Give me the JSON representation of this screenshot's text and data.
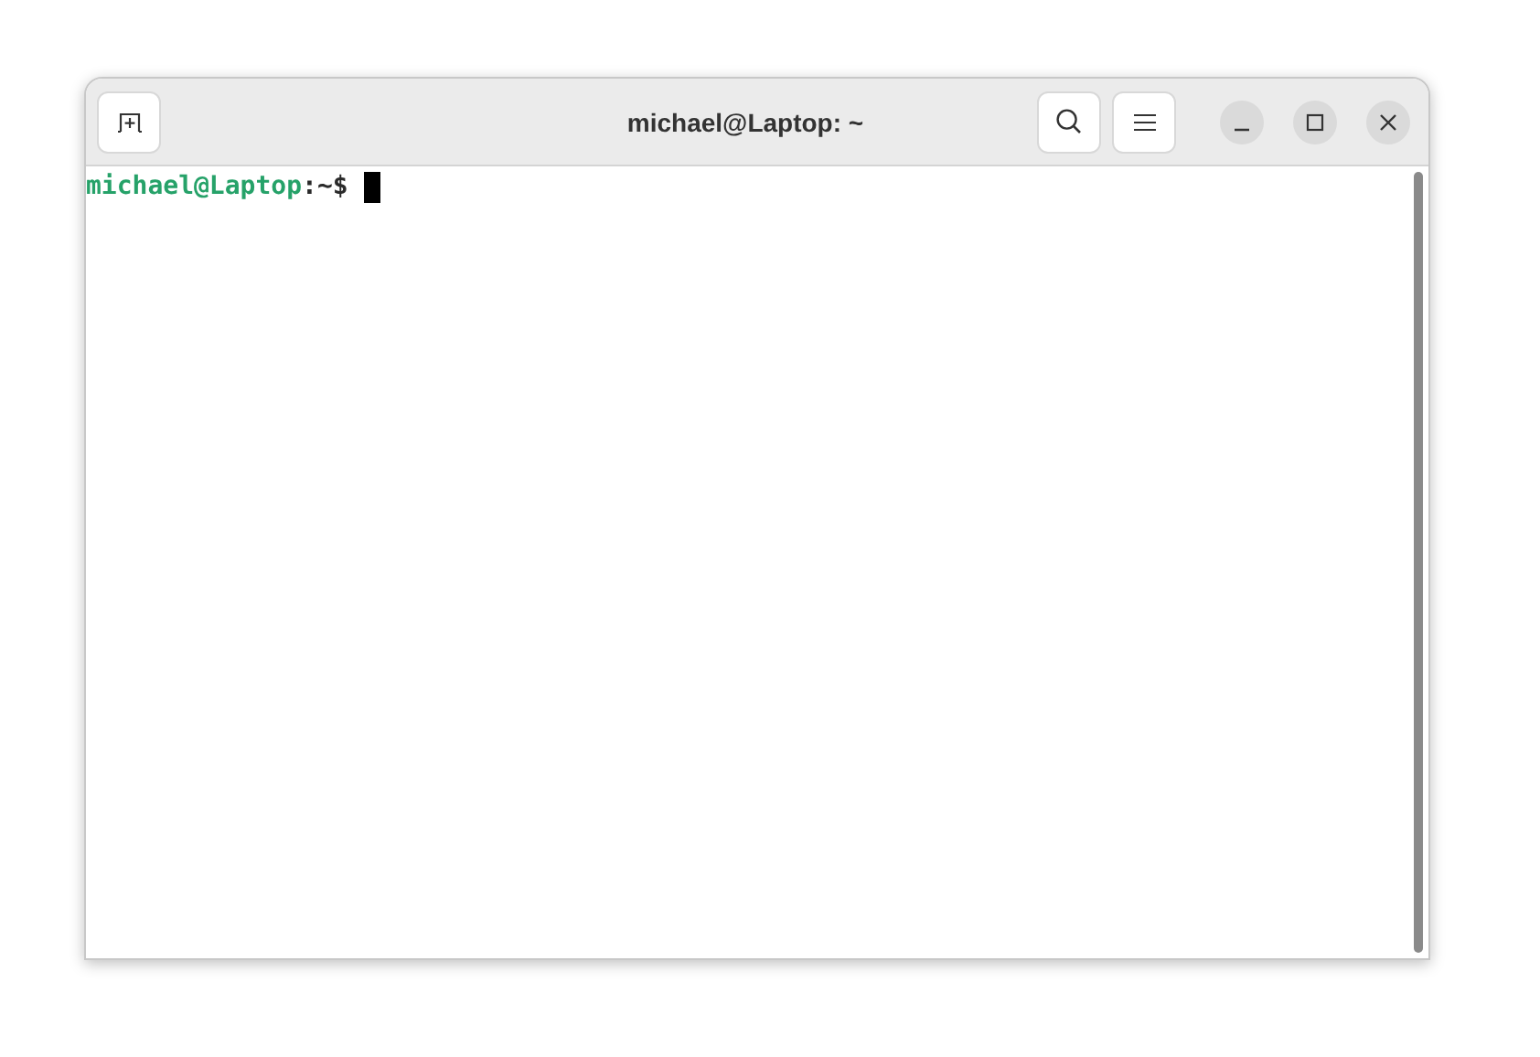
{
  "window": {
    "title": "michael@Laptop: ~"
  },
  "terminal": {
    "prompt_user_host": "michael@Laptop",
    "prompt_rest": ":~$"
  }
}
